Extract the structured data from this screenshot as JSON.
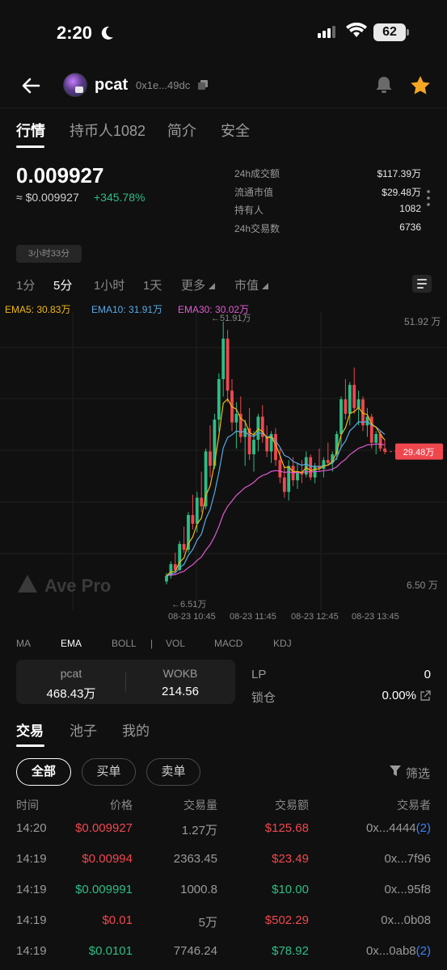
{
  "status": {
    "time": "2:20",
    "battery": "62"
  },
  "header": {
    "token_name": "pcat",
    "address": "0x1e...49dc"
  },
  "tabs": [
    {
      "label": "行情"
    },
    {
      "label": "持币人1082"
    },
    {
      "label": "简介"
    },
    {
      "label": "安全"
    }
  ],
  "price": {
    "main": "0.009927",
    "usd": "≈ $0.009927",
    "change": "+345.78%",
    "age": "3小时33分"
  },
  "stats": [
    {
      "label": "24h成交额",
      "value": "$117.39万"
    },
    {
      "label": "流通市值",
      "value": "$29.48万"
    },
    {
      "label": "持有人",
      "value": "1082"
    },
    {
      "label": "24h交易数",
      "value": "6736"
    }
  ],
  "timeframes": [
    {
      "label": "1分"
    },
    {
      "label": "5分"
    },
    {
      "label": "1小时"
    },
    {
      "label": "1天"
    },
    {
      "label": "更多"
    },
    {
      "label": "市值"
    }
  ],
  "ema_legend": [
    {
      "label": "EMA5: 30.83万",
      "color": "#f0b90b"
    },
    {
      "label": "EMA10: 31.91万",
      "color": "#5aa9e6"
    },
    {
      "label": "EMA30: 30.02万",
      "color": "#e05bd0"
    }
  ],
  "chart_data": {
    "type": "candlestick",
    "watermark": "Ave Pro",
    "x_ticks": [
      "08-23 10:45",
      "08-23 11:45",
      "08-23 12:45",
      "08-23 13:45"
    ],
    "y_ticks": [
      "51.92 万",
      "6.50 万"
    ],
    "ylim": [
      6.5,
      51.92
    ],
    "high_marker": "←51.91万",
    "low_marker": "←6.51万",
    "current_label": "29.48万",
    "current_value": 29.48,
    "candles": [
      [
        7.0,
        8.5,
        6.51,
        8.0
      ],
      [
        8.0,
        10.5,
        7.5,
        10.0
      ],
      [
        10.0,
        12.0,
        8.5,
        9.0
      ],
      [
        9.0,
        14.0,
        8.8,
        13.5
      ],
      [
        13.5,
        16.5,
        12.0,
        12.5
      ],
      [
        12.5,
        19.0,
        12.0,
        18.5
      ],
      [
        18.5,
        22.0,
        16.0,
        17.0
      ],
      [
        17.0,
        22.5,
        15.5,
        21.5
      ],
      [
        21.5,
        26.0,
        19.0,
        20.0
      ],
      [
        20.0,
        30.0,
        19.5,
        29.5
      ],
      [
        29.5,
        34.0,
        25.0,
        27.0
      ],
      [
        27.0,
        36.0,
        26.5,
        35.0
      ],
      [
        35.0,
        43.0,
        33.0,
        42.0
      ],
      [
        42.0,
        51.91,
        39.0,
        49.0
      ],
      [
        49.0,
        50.5,
        38.0,
        40.0
      ],
      [
        40.0,
        42.0,
        33.0,
        34.5
      ],
      [
        34.5,
        38.0,
        30.0,
        36.0
      ],
      [
        36.0,
        39.0,
        31.0,
        32.0
      ],
      [
        32.0,
        35.0,
        27.0,
        33.5
      ],
      [
        33.5,
        37.0,
        28.0,
        29.0
      ],
      [
        29.0,
        33.0,
        26.0,
        31.5
      ],
      [
        31.5,
        36.0,
        29.5,
        35.5
      ],
      [
        35.5,
        37.5,
        31.0,
        32.0
      ],
      [
        32.0,
        34.0,
        28.5,
        29.5
      ],
      [
        29.5,
        33.0,
        27.5,
        32.5
      ],
      [
        32.5,
        33.5,
        27.0,
        28.0
      ],
      [
        28.0,
        30.0,
        24.0,
        25.0
      ],
      [
        25.0,
        27.0,
        21.5,
        22.5
      ],
      [
        22.5,
        28.0,
        21.0,
        27.0
      ],
      [
        27.0,
        28.5,
        23.5,
        24.5
      ],
      [
        24.5,
        27.5,
        23.0,
        26.0
      ],
      [
        26.0,
        28.0,
        24.0,
        25.5
      ],
      [
        25.5,
        29.5,
        25.0,
        28.5
      ],
      [
        28.5,
        29.0,
        24.5,
        25.0
      ],
      [
        25.0,
        27.5,
        24.0,
        27.0
      ],
      [
        27.0,
        30.0,
        26.0,
        26.5
      ],
      [
        26.5,
        28.5,
        25.0,
        28.0
      ],
      [
        28.0,
        31.0,
        27.0,
        27.5
      ],
      [
        27.5,
        29.5,
        26.0,
        29.0
      ],
      [
        29.0,
        33.0,
        28.0,
        32.5
      ],
      [
        32.5,
        39.0,
        30.0,
        38.5
      ],
      [
        38.5,
        42.0,
        35.0,
        36.0
      ],
      [
        36.0,
        41.5,
        34.0,
        41.0
      ],
      [
        41.0,
        44.0,
        36.0,
        37.0
      ],
      [
        37.0,
        40.0,
        34.0,
        38.5
      ],
      [
        38.5,
        39.0,
        33.0,
        34.0
      ],
      [
        34.0,
        37.0,
        32.0,
        35.5
      ],
      [
        35.5,
        36.0,
        30.0,
        31.0
      ],
      [
        31.0,
        33.0,
        29.0,
        32.5
      ],
      [
        32.5,
        33.0,
        29.5,
        30.0
      ],
      [
        30.0,
        31.5,
        29.0,
        29.48
      ]
    ]
  },
  "indicators": [
    {
      "label": "MA"
    },
    {
      "label": "EMA"
    },
    {
      "label": "BOLL"
    },
    {
      "label": "|"
    },
    {
      "label": "VOL"
    },
    {
      "label": "MACD"
    },
    {
      "label": "KDJ"
    }
  ],
  "pool": {
    "token_label": "pcat",
    "token_value": "468.43万",
    "quote_label": "WOKB",
    "quote_value": "214.56",
    "lp_label": "LP",
    "lp_value": "0",
    "lock_label": "锁仓",
    "lock_value": "0.00%"
  },
  "trade_tabs": [
    {
      "label": "交易"
    },
    {
      "label": "池子"
    },
    {
      "label": "我的"
    }
  ],
  "filters": [
    {
      "label": "全部"
    },
    {
      "label": "买单"
    },
    {
      "label": "卖单"
    }
  ],
  "filter_label": "筛选",
  "table_headers": {
    "time": "时间",
    "price": "价格",
    "qty": "交易量",
    "amount": "交易额",
    "trader": "交易者"
  },
  "trades": [
    {
      "time": "14:20",
      "price": "$0.009927",
      "qty": "1.27万",
      "amount": "$125.68",
      "trader": "0x...4444",
      "count": "(2)",
      "side": "sell"
    },
    {
      "time": "14:19",
      "price": "$0.00994",
      "qty": "2363.45",
      "amount": "$23.49",
      "trader": "0x...7f96",
      "count": "",
      "side": "sell"
    },
    {
      "time": "14:19",
      "price": "$0.009991",
      "qty": "1000.8",
      "amount": "$10.00",
      "trader": "0x...95f8",
      "count": "",
      "side": "buy"
    },
    {
      "time": "14:19",
      "price": "$0.01",
      "qty": "5万",
      "amount": "$502.29",
      "trader": "0x...0b08",
      "count": "",
      "side": "sell"
    },
    {
      "time": "14:19",
      "price": "$0.0101",
      "qty": "7746.24",
      "amount": "$78.92",
      "trader": "0x...0ab8",
      "count": "(2)",
      "side": "buy"
    }
  ]
}
